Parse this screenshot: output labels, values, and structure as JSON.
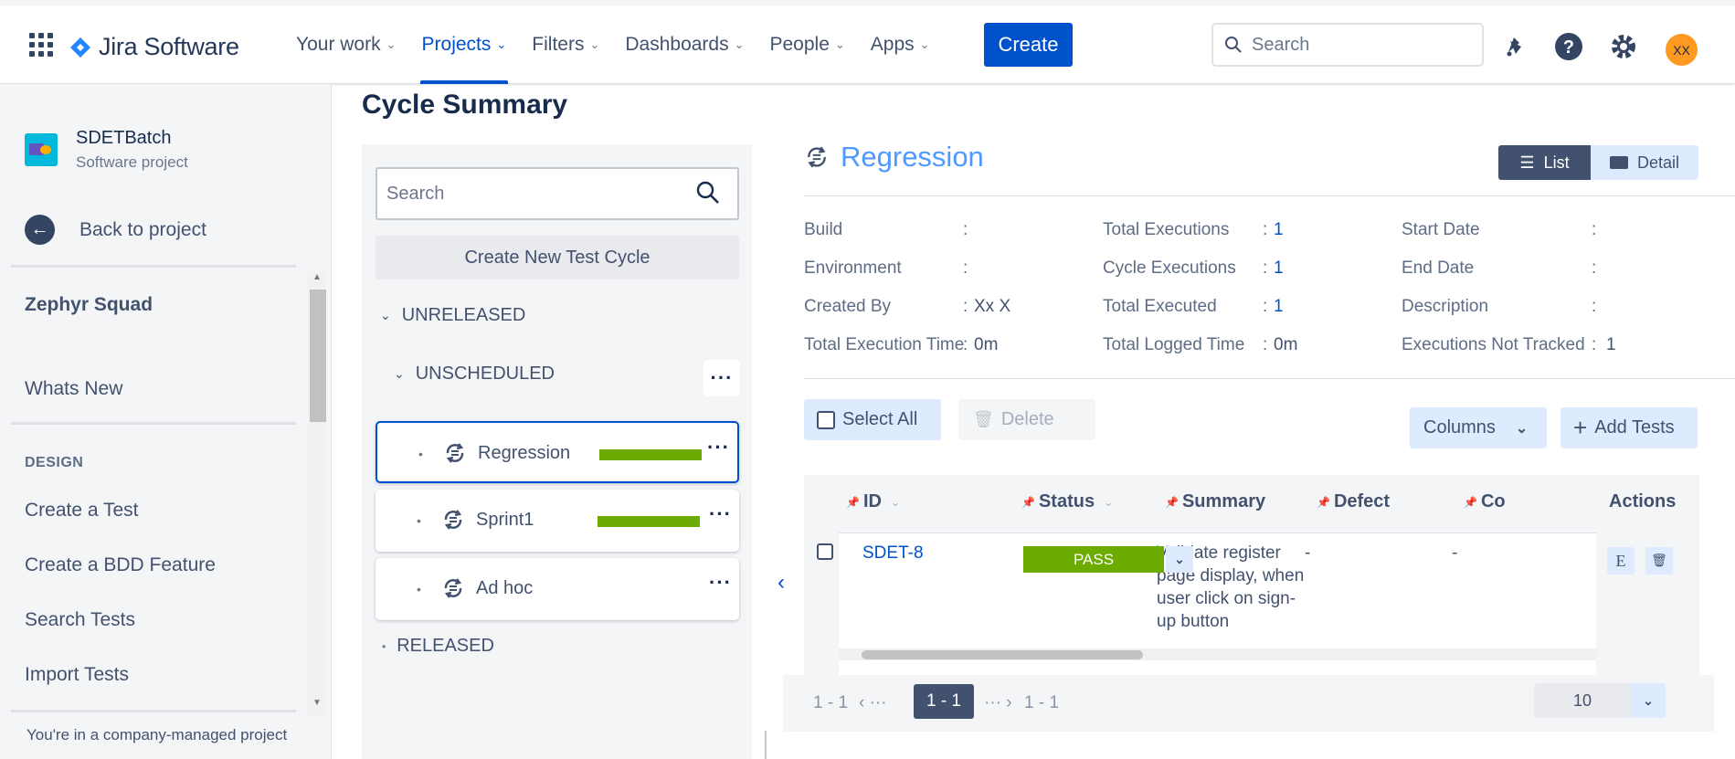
{
  "app": {
    "brand": "Jira Software"
  },
  "nav": {
    "items": [
      {
        "label": "Your work"
      },
      {
        "label": "Projects"
      },
      {
        "label": "Filters"
      },
      {
        "label": "Dashboards"
      },
      {
        "label": "People"
      },
      {
        "label": "Apps"
      }
    ],
    "active": "Projects",
    "create_label": "Create",
    "search_placeholder": "Search",
    "avatar_initials": "XX"
  },
  "sidebar": {
    "project_name": "SDETBatch",
    "project_type": "Software project",
    "back_label": "Back to project",
    "section_title": "Zephyr Squad",
    "whats_new": "Whats New",
    "design_heading": "DESIGN",
    "design_items": [
      "Create a Test",
      "Create a BDD Feature",
      "Search Tests",
      "Import Tests"
    ],
    "footer": "You're in a company-managed project"
  },
  "page": {
    "title": "Cycle Summary"
  },
  "tree": {
    "search_placeholder": "Search",
    "new_cycle_label": "Create New Test Cycle",
    "unreleased": "UNRELEASED",
    "unscheduled": "UNSCHEDULED",
    "cycles": [
      {
        "name": "Regression",
        "progress": 1.0,
        "selected": true
      },
      {
        "name": "Sprint1",
        "progress": 1.0,
        "selected": false
      },
      {
        "name": "Ad hoc",
        "progress": null,
        "selected": false
      }
    ],
    "released": "RELEASED"
  },
  "cycle": {
    "name": "Regression",
    "view_list": "List",
    "view_detail": "Detail",
    "info": {
      "build_label": "Build",
      "build_value": "",
      "environment_label": "Environment",
      "environment_value": "",
      "created_by_label": "Created By",
      "created_by_value": "Xx X",
      "total_exec_time_label": "Total Execution Time",
      "total_exec_time_value": "0m",
      "total_executions_label": "Total Executions",
      "total_executions_value": "1",
      "cycle_executions_label": "Cycle Executions",
      "cycle_executions_value": "1",
      "total_executed_label": "Total Executed",
      "total_executed_value": "1",
      "total_logged_label": "Total Logged Time",
      "total_logged_value": "0m",
      "start_date_label": "Start Date",
      "start_date_value": "",
      "end_date_label": "End Date",
      "end_date_value": "",
      "description_label": "Description",
      "description_value": "",
      "not_tracked_label": "Executions Not Tracked",
      "not_tracked_value": "1"
    },
    "colon": ":",
    "select_all": "Select All",
    "delete": "Delete",
    "columns": "Columns",
    "add_tests": "Add Tests"
  },
  "grid": {
    "headers": {
      "id": "ID",
      "status": "Status",
      "summary": "Summary",
      "defect": "Defect",
      "comment": "Co",
      "actions": "Actions"
    },
    "rows": [
      {
        "id": "SDET-8",
        "status": "PASS",
        "summary_lines": [
          "Validate register",
          "page display, when",
          "user click on sign-",
          "up button"
        ],
        "defect": "-",
        "comment": "-",
        "action_e": "E"
      }
    ]
  },
  "pager": {
    "range_left": "1 - 1",
    "prev": "‹ ···",
    "current": "1 - 1",
    "next": "··· ›",
    "range_right": "1 - 1",
    "per_page": "10"
  },
  "colors": {
    "accent": "#0052cc",
    "pass": "#6cab00",
    "link": "#4c9aff"
  }
}
